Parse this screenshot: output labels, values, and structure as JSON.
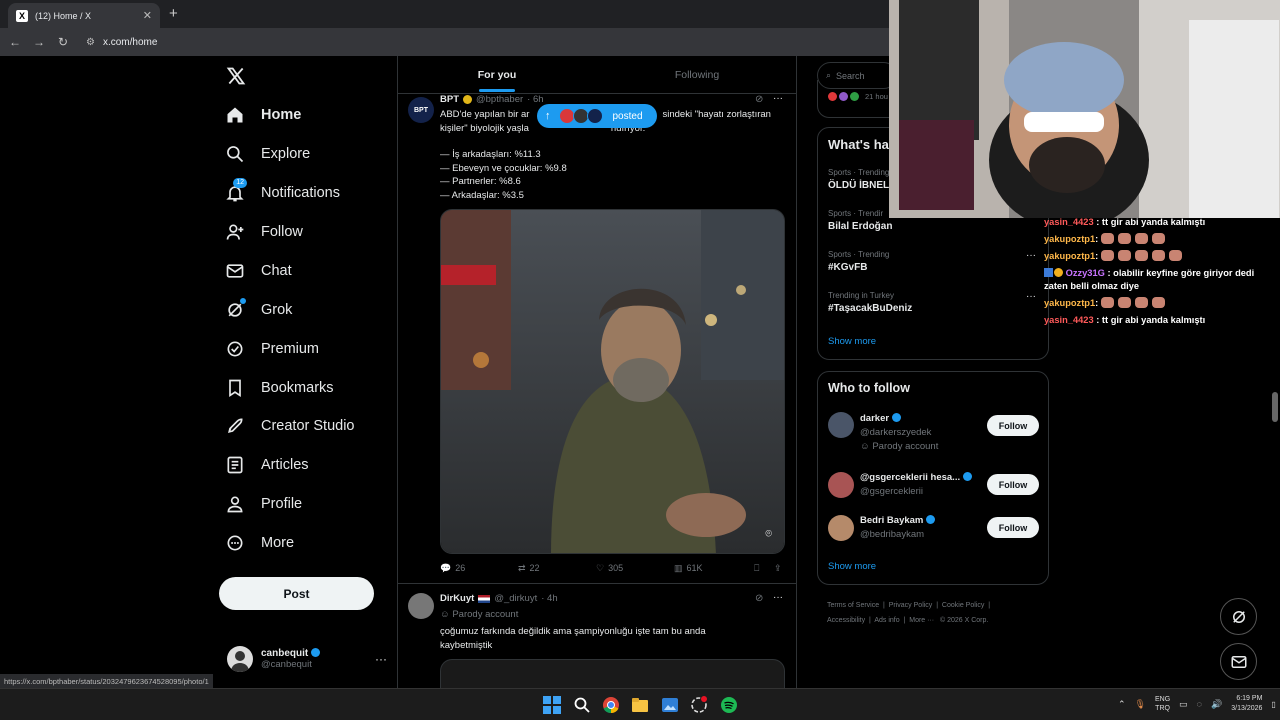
{
  "browser": {
    "tab_title": "(12) Home / X",
    "url": "x.com/home",
    "status_url": "https://x.com/bpthaber/status/2032479623674528095/photo/1"
  },
  "nav": {
    "items": [
      {
        "label": "Home",
        "icon": "home-icon"
      },
      {
        "label": "Explore",
        "icon": "search-icon"
      },
      {
        "label": "Notifications",
        "icon": "bell-icon",
        "badge": "12"
      },
      {
        "label": "Follow",
        "icon": "person-add-icon"
      },
      {
        "label": "Chat",
        "icon": "mail-icon"
      },
      {
        "label": "Grok",
        "icon": "grok-icon"
      },
      {
        "label": "Premium",
        "icon": "verified-icon"
      },
      {
        "label": "Bookmarks",
        "icon": "bookmark-icon"
      },
      {
        "label": "Creator Studio",
        "icon": "rocket-icon"
      },
      {
        "label": "Articles",
        "icon": "article-icon"
      },
      {
        "label": "Profile",
        "icon": "person-icon"
      },
      {
        "label": "More",
        "icon": "more-circle-icon"
      }
    ],
    "post_label": "Post",
    "account": {
      "name": "canbequit",
      "handle": "@canbequit"
    }
  },
  "feed": {
    "tabs": [
      "For you",
      "Following"
    ],
    "new_posts_label": "posted",
    "tweet1": {
      "name": "BPT",
      "handle": "@bpthaber",
      "time": "· 6h",
      "text_line1a": "ABD'de yapılan bir ar",
      "text_line1b": "sindeki \"hayatı zorlaştıran",
      "text_line2a": "kişiler\" biyolojik yaşla",
      "text_line2b": "ndırıyor.",
      "list": [
        "— İş arkadaşları: %11.3",
        "— Ebeveyn ve çocuklar: %9.8",
        "— Partnerler: %8.6",
        "— Arkadaşlar: %3.5"
      ],
      "replies": "26",
      "reposts": "22",
      "likes": "305",
      "views": "61K"
    },
    "tweet2": {
      "name": "DirKuyt",
      "handle": "@_dirkuyt",
      "time": "· 4h",
      "label": "Parody account",
      "text1": "çoğumuz farkında değildik ama şampiyonluğu işte tam bu anda",
      "text2": "kaybetmiştik"
    }
  },
  "right": {
    "search_placeholder": "Search",
    "top_time": "21 hou",
    "happening_title": "What's ha",
    "trends": [
      {
        "meta": "Sports · Trending",
        "name": "ÖLDÜ İBNELE"
      },
      {
        "meta": "Sports · Trendir",
        "name": "Bilal Erdoğan"
      },
      {
        "meta": "Sports · Trending",
        "name": "#KGvFB"
      },
      {
        "meta": "Trending in Turkey",
        "name": "#TaşacakBuDeniz"
      }
    ],
    "show_more": "Show more",
    "who_title": "Who to follow",
    "who": [
      {
        "name": "darker",
        "handle": "@darkerszyedek",
        "sub": "Parody account"
      },
      {
        "name": "@gsgerceklerii hesa...",
        "handle": "@gsgerceklerii",
        "sub": ""
      },
      {
        "name": "Bedri Baykam",
        "handle": "@bedribaykam",
        "sub": ""
      }
    ],
    "follow_label": "Follow",
    "footer": [
      "Terms of Service",
      "Privacy Policy",
      "Cookie Policy",
      "Accessibility",
      "Ads info",
      "More ···",
      "© 2026 X Corp."
    ]
  },
  "chat": [
    {
      "user": "yasin_4423",
      "msg": ": tt gir abi yanda kalmıştı",
      "cls": "u1",
      "hands": 0
    },
    {
      "user": "yakupoztp1",
      "msg": ":",
      "cls": "u2",
      "hands": 4
    },
    {
      "user": "yakupoztp1",
      "msg": ":",
      "cls": "u2",
      "hands": 5
    },
    {
      "user": "Ozzy31G",
      "msg": ": olabilir keyfine göre giriyor dedi zaten belli olmaz diye",
      "cls": "u3",
      "hands": 0
    },
    {
      "user": "yakupoztp1",
      "msg": ":",
      "cls": "u2",
      "hands": 4
    },
    {
      "user": "yasin_4423",
      "msg": ": tt gir abi yanda kalmıştı",
      "cls": "u1",
      "hands": 0
    }
  ],
  "taskbar": {
    "lang1": "ENG",
    "lang2": "TRQ",
    "time": "6:19 PM",
    "date": "3/13/2026"
  },
  "colors": {
    "accent": "#1d9bf0",
    "background": "#000000",
    "border": "#2f3336"
  }
}
